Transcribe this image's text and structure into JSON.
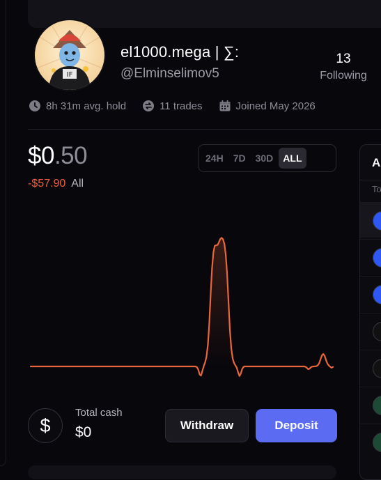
{
  "profile": {
    "username": "el1000.mega | ∑:",
    "handle": "@Elminselimov5",
    "following_count": "13",
    "following_label": "Following"
  },
  "stats": {
    "avg_hold": "8h 31m avg. hold",
    "trades": "11 trades",
    "joined": "Joined May 2026"
  },
  "portfolio": {
    "balance_main": "$0",
    "balance_cents": ".50",
    "pnl": "-$57.90",
    "pnl_period": "All"
  },
  "time_range": {
    "options": [
      "24H",
      "7D",
      "30D",
      "ALL"
    ],
    "selected": "ALL"
  },
  "chart_data": {
    "type": "line",
    "series_color": "#e8663c",
    "shape": "flat baseline with one tall double-peaked spike near the middle and a small bump at the right end",
    "values": [
      0.05,
      0.05,
      0.05,
      0.05,
      0.05,
      0.05,
      0.05,
      0.05,
      0.05,
      0.05,
      0.05,
      0.05,
      0.05,
      0.05,
      0.05,
      0.05,
      0.05,
      0.05,
      0.05,
      0.05,
      0.05,
      0.05,
      0.05,
      0.05,
      0.05,
      0.05,
      0.05,
      0.05,
      0.05,
      0.05,
      0.05,
      0.05,
      0.05,
      0.05,
      0.05,
      0.05,
      0.05,
      0.05,
      0.05,
      0.05,
      0.05,
      0.05,
      0.05,
      0.05,
      0.05,
      0.05,
      0.05,
      0.05,
      0.05,
      0.05,
      0.05,
      0.05,
      0.05,
      0.05,
      0.05,
      0.05,
      0.05,
      0.05,
      0.05,
      0.05,
      0.05,
      0.05,
      0.05,
      0.05,
      0.05,
      0.05,
      0.05,
      0.05,
      0.05,
      0.05,
      0.05,
      0.05,
      0.05,
      0.05,
      0.05,
      0.05,
      0.05,
      0.05,
      0.05,
      0.05,
      0.05,
      0.05,
      0.05,
      0.05,
      0.05,
      0.05,
      0.05,
      0.05,
      0.05,
      0.05,
      0.05,
      0.05,
      0.05,
      0.05,
      0.05,
      0.05,
      0.05,
      0.05,
      0.05,
      0.05,
      0.05,
      0.05,
      0.05,
      0.05,
      0.05,
      0.05,
      0.05,
      0.05,
      0.05,
      0.05,
      0.05,
      0.05,
      0.05,
      0.05,
      0.05,
      0.05,
      0.05,
      0.05,
      0.05,
      0.05,
      0.05,
      0.05,
      0.05,
      0.05,
      0.05,
      0.05,
      0.05,
      0.05,
      0.05,
      0.05,
      0.05,
      0.05,
      0.05,
      0.05,
      0.05,
      0.05,
      0.05,
      0.05,
      0.05,
      0.05,
      0.05,
      0.05,
      0.05,
      0.05,
      0.05,
      0.05,
      0.05,
      0.05,
      0.05,
      0.05,
      0.05,
      0.05,
      0.05,
      0.05,
      0.05,
      0.05,
      0.05,
      0.05,
      0.05,
      0.05,
      0.05,
      0.05,
      0.05,
      0.05,
      0.05,
      0.05,
      0.05,
      0.05,
      0.05,
      0.05,
      0.05,
      0.05,
      0.05,
      0.05,
      0.05,
      0.05,
      0.05,
      0.05,
      0.05,
      0.05,
      0.05,
      0.05,
      0.05,
      0.05,
      0.05,
      0.05,
      0.05,
      0.05,
      0.05,
      0.05,
      0.05,
      0.05,
      0.05,
      0.05,
      0.05,
      0.05,
      0.05,
      0.05,
      0.05,
      0.05,
      0.05,
      0.05,
      0.05,
      0.05,
      0.05,
      0.05,
      0.05,
      0.05,
      0.05,
      0.05,
      0.05,
      0.05,
      0.05,
      0.05,
      0.05,
      0.05,
      0.05,
      0.05,
      0.05,
      0.05,
      0.05,
      0.05,
      0.05,
      0.05,
      0.05,
      0.05,
      0.05,
      0.05,
      0.05,
      0.05,
      0.05,
      0.05,
      0.05,
      0.05,
      0.05,
      0.05,
      0.05,
      0.05,
      0.05,
      0.05,
      0.05,
      0.05,
      0.05,
      0.05,
      0.05,
      0.05,
      0.05,
      0.05,
      0.05,
      0.05,
      0.05,
      0.05,
      0.05,
      0.05,
      0.05,
      0.05,
      0.05,
      0.05,
      0.05,
      0.05,
      0.05
    ]
  },
  "cash": {
    "icon": "dollar-icon",
    "label": "Total cash",
    "value": "$0"
  },
  "actions": {
    "withdraw_label": "Withdraw",
    "deposit_label": "Deposit",
    "deposit_color": "#5b6cf2"
  },
  "side_panel": {
    "header": "A",
    "subheader": "To",
    "rows": [
      {
        "icon": "blue-token-icon",
        "color": "#2f57f5"
      },
      {
        "icon": "blue-token-icon",
        "color": "#2f57f5"
      },
      {
        "icon": "blue-token-icon",
        "color": "#2f57f5"
      },
      {
        "icon": "dark-token-icon",
        "color": "#111111"
      },
      {
        "icon": "dark-token-icon",
        "color": "#111111"
      },
      {
        "icon": "green-token-icon",
        "color": "#1d4a35"
      },
      {
        "icon": "green-token-icon",
        "color": "#1d4a35"
      }
    ]
  }
}
